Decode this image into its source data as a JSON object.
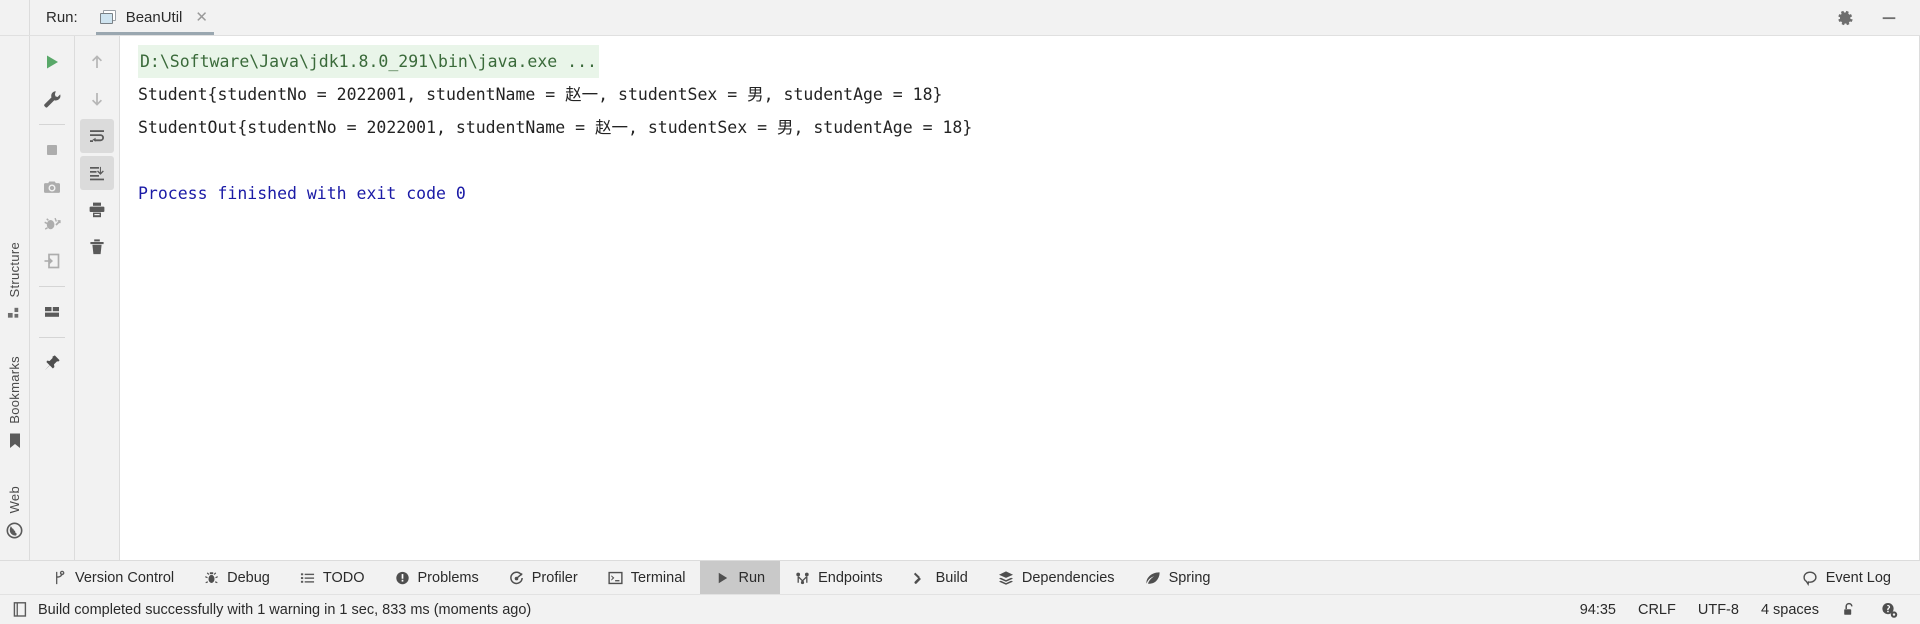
{
  "window": {
    "run_label": "Run:",
    "tab_name": "BeanUtil",
    "close_icon": "close-icon",
    "settings_icon": "gear-icon",
    "minimize_icon": "minimize-icon"
  },
  "left_strip": {
    "items": [
      {
        "label": "Structure",
        "icon": "structure-icon"
      },
      {
        "label": "Bookmarks",
        "icon": "bookmark-icon"
      },
      {
        "label": "Web",
        "icon": "globe-icon"
      }
    ]
  },
  "run_toolbar": {
    "buttons": [
      {
        "name": "rerun-button",
        "icon": "play-icon",
        "color": "#59a869"
      },
      {
        "name": "edit-configuration-button",
        "icon": "wrench-icon",
        "color": "#6e6e6e"
      },
      {
        "name": "stop-button",
        "icon": "stop-square-icon",
        "color": "#a6a6a6"
      },
      {
        "name": "screenshot-button",
        "icon": "camera-icon",
        "color": "#a6a6a6"
      },
      {
        "name": "attach-debugger-button",
        "icon": "bug-icon",
        "color": "#a6a6a6"
      },
      {
        "name": "export-button",
        "icon": "arrow-into-box-icon",
        "color": "#a6a6a6"
      },
      {
        "name": "layout-button",
        "icon": "layout-icon",
        "color": "#6e6e6e"
      },
      {
        "name": "pin-tab-button",
        "icon": "pin-icon",
        "color": "#5a5a5a"
      }
    ]
  },
  "console_toolbar": {
    "buttons": [
      {
        "name": "previous-occurrence-button",
        "icon": "arrow-up-icon",
        "active": false
      },
      {
        "name": "next-occurrence-button",
        "icon": "arrow-down-icon",
        "active": false
      },
      {
        "name": "soft-wrap-button",
        "icon": "soft-wrap-icon",
        "active": true
      },
      {
        "name": "scroll-to-end-button",
        "icon": "scroll-to-end-icon",
        "active": true
      },
      {
        "name": "print-button",
        "icon": "printer-icon",
        "active": false
      },
      {
        "name": "clear-all-button",
        "icon": "trash-icon",
        "active": false
      }
    ]
  },
  "console": {
    "lines": [
      {
        "type": "command",
        "text": "D:\\Software\\Java\\jdk1.8.0_291\\bin\\java.exe ..."
      },
      {
        "type": "output",
        "text": "Student{studentNo = 2022001, studentName = 赵一, studentSex = 男, studentAge = 18}"
      },
      {
        "type": "output",
        "text": "StudentOut{studentNo = 2022001, studentName = 赵一, studentSex = 男, studentAge = 18}"
      },
      {
        "type": "blank",
        "text": ""
      },
      {
        "type": "exit",
        "text": "Process finished with exit code 0"
      }
    ]
  },
  "bottom_bar": {
    "items": [
      {
        "label": "Version Control",
        "icon": "branch-icon",
        "selected": false
      },
      {
        "label": "Debug",
        "icon": "bug-icon",
        "selected": false
      },
      {
        "label": "TODO",
        "icon": "list-icon",
        "selected": false
      },
      {
        "label": "Problems",
        "icon": "warning-icon",
        "selected": false
      },
      {
        "label": "Profiler",
        "icon": "profiler-icon",
        "selected": false
      },
      {
        "label": "Terminal",
        "icon": "terminal-icon",
        "selected": false
      },
      {
        "label": "Run",
        "icon": "play-icon",
        "selected": true
      },
      {
        "label": "Endpoints",
        "icon": "endpoints-icon",
        "selected": false
      },
      {
        "label": "Build",
        "icon": "hammer-icon",
        "selected": false
      },
      {
        "label": "Dependencies",
        "icon": "layers-icon",
        "selected": false
      },
      {
        "label": "Spring",
        "icon": "spring-leaf-icon",
        "selected": false
      }
    ],
    "event_log": {
      "label": "Event Log",
      "icon": "balloon-icon"
    }
  },
  "status_bar": {
    "message": "Build completed successfully with 1 warning in 1 sec, 833 ms (moments ago)",
    "message_icon": "book-icon",
    "caret_position": "94:35",
    "line_separator": "CRLF",
    "encoding": "UTF-8",
    "indent": "4 spaces",
    "lock_icon": "unlocked-icon",
    "inspection_icon": "inspection-icon"
  },
  "colors": {
    "accent_green": "#59a869",
    "exit_blue": "#1a1aa6",
    "cmd_green_text": "#3a6a3a",
    "cmd_green_bg": "#e9f5e9",
    "panel_bg": "#f2f2f2",
    "console_bg": "#ffffff",
    "selected_tab_bg": "#c9c9c9"
  }
}
